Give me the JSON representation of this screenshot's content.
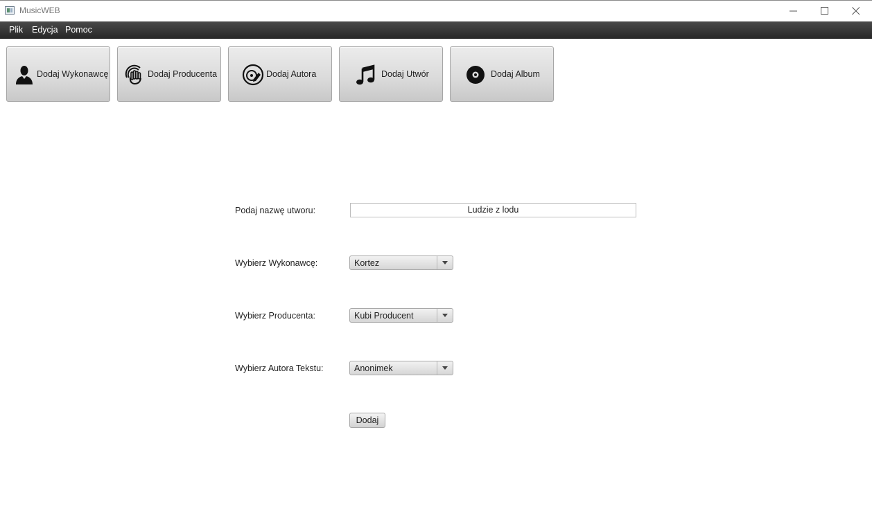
{
  "window": {
    "title": "MusicWEB",
    "controls": {
      "minimize": "minimize-icon",
      "maximize": "maximize-icon",
      "close": "close-icon"
    }
  },
  "menu": {
    "items": [
      {
        "label": "Plik"
      },
      {
        "label": "Edycja"
      },
      {
        "label": "Pomoc"
      }
    ]
  },
  "toolbar": {
    "buttons": [
      {
        "label": "Dodaj Wykonawcę",
        "icon": "person-icon"
      },
      {
        "label": "Dodaj Producenta",
        "icon": "producer-hand-icon"
      },
      {
        "label": "Dodaj Autora",
        "icon": "author-pen-disc-icon"
      },
      {
        "label": "Dodaj Utwór",
        "icon": "music-note-icon"
      },
      {
        "label": "Dodaj Album",
        "icon": "vinyl-disc-icon"
      }
    ]
  },
  "form": {
    "title_label": "Podaj nazwę utworu:",
    "title_value": "Ludzie z lodu",
    "artist_label": "Wybierz Wykonawcę:",
    "artist_value": "Kortez",
    "producer_label": "Wybierz Producenta:",
    "producer_value": "Kubi Producent",
    "author_label": "Wybierz Autora Tekstu:",
    "author_value": "Anonimek",
    "submit_label": "Dodaj"
  }
}
